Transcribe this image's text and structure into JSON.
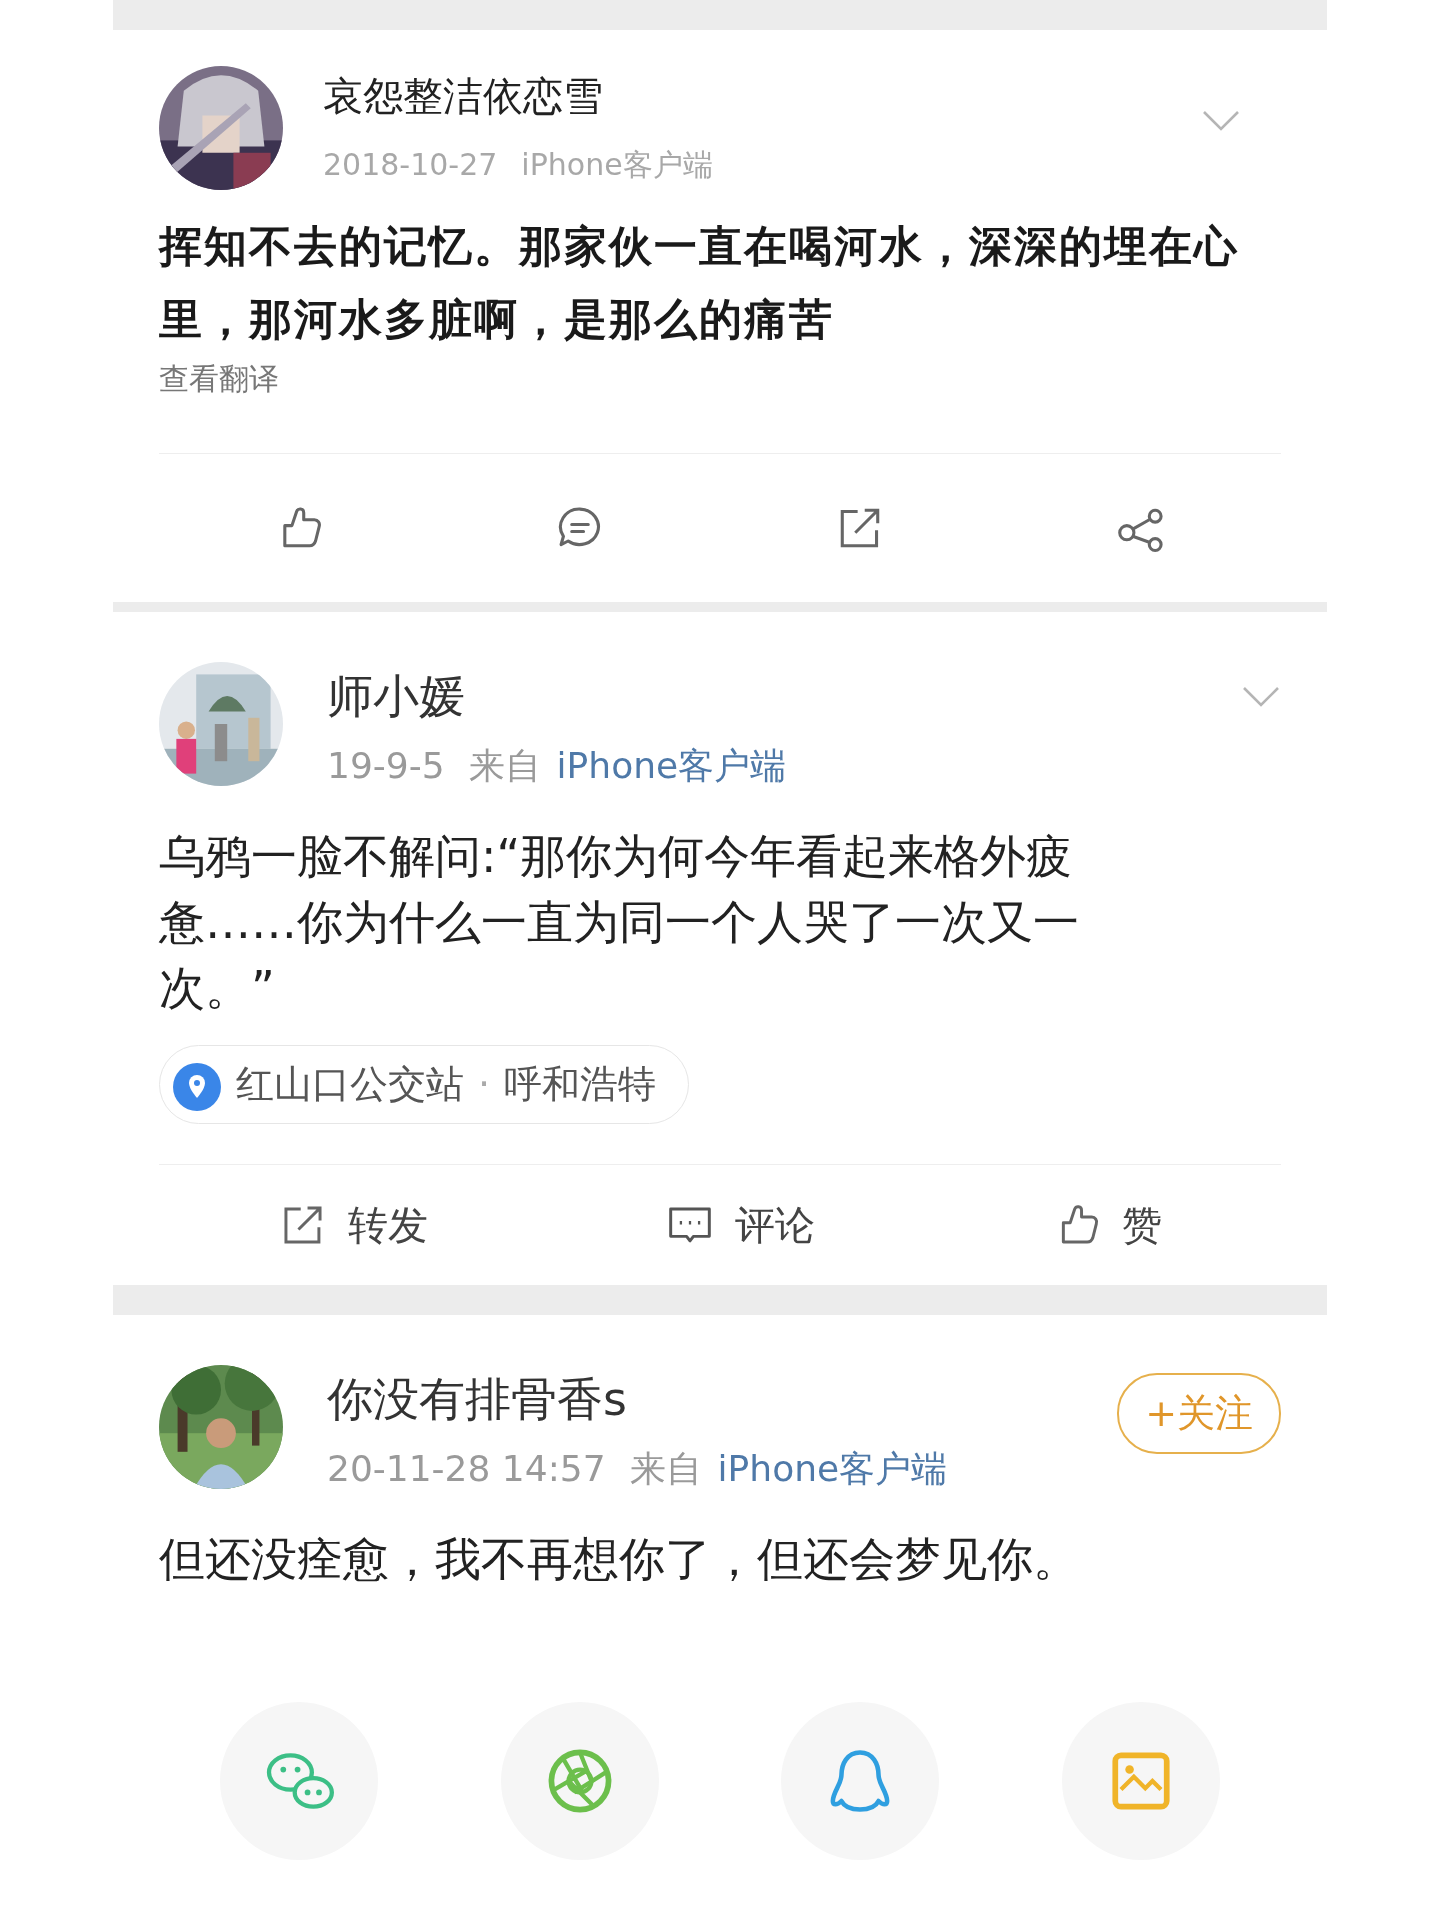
{
  "posts": [
    {
      "kind": "old",
      "author": "哀怨整洁依恋雪",
      "time": "2018-10-27",
      "source": "iPhone客户端",
      "text": "挥知不去的记忆。那家伙一直在喝河水，深深的埋在心里，那河水多脏啊，是那么的痛苦",
      "translate": "查看翻译"
    },
    {
      "kind": "new",
      "author": "师小媛",
      "time": "19-9-5",
      "source_prefix": "来自",
      "source": "iPhone客户端",
      "text": "乌鸦一脸不解问:“那你为何今年看起来格外疲惫……你为什么一直为同一个人哭了一次又一次。”",
      "location": {
        "place": "红山口公交站",
        "separator": "·",
        "city": "呼和浩特"
      },
      "actions": [
        {
          "label": "转发"
        },
        {
          "label": "评论"
        },
        {
          "label": "赞"
        }
      ]
    },
    {
      "kind": "share",
      "author": "你没有排骨香s",
      "time": "20-11-28 14:57",
      "source_prefix": "来自",
      "source": "iPhone客户端",
      "follow": "+关注",
      "text": "但还没痊愈，我不再想你了，但还会梦见你。"
    }
  ]
}
